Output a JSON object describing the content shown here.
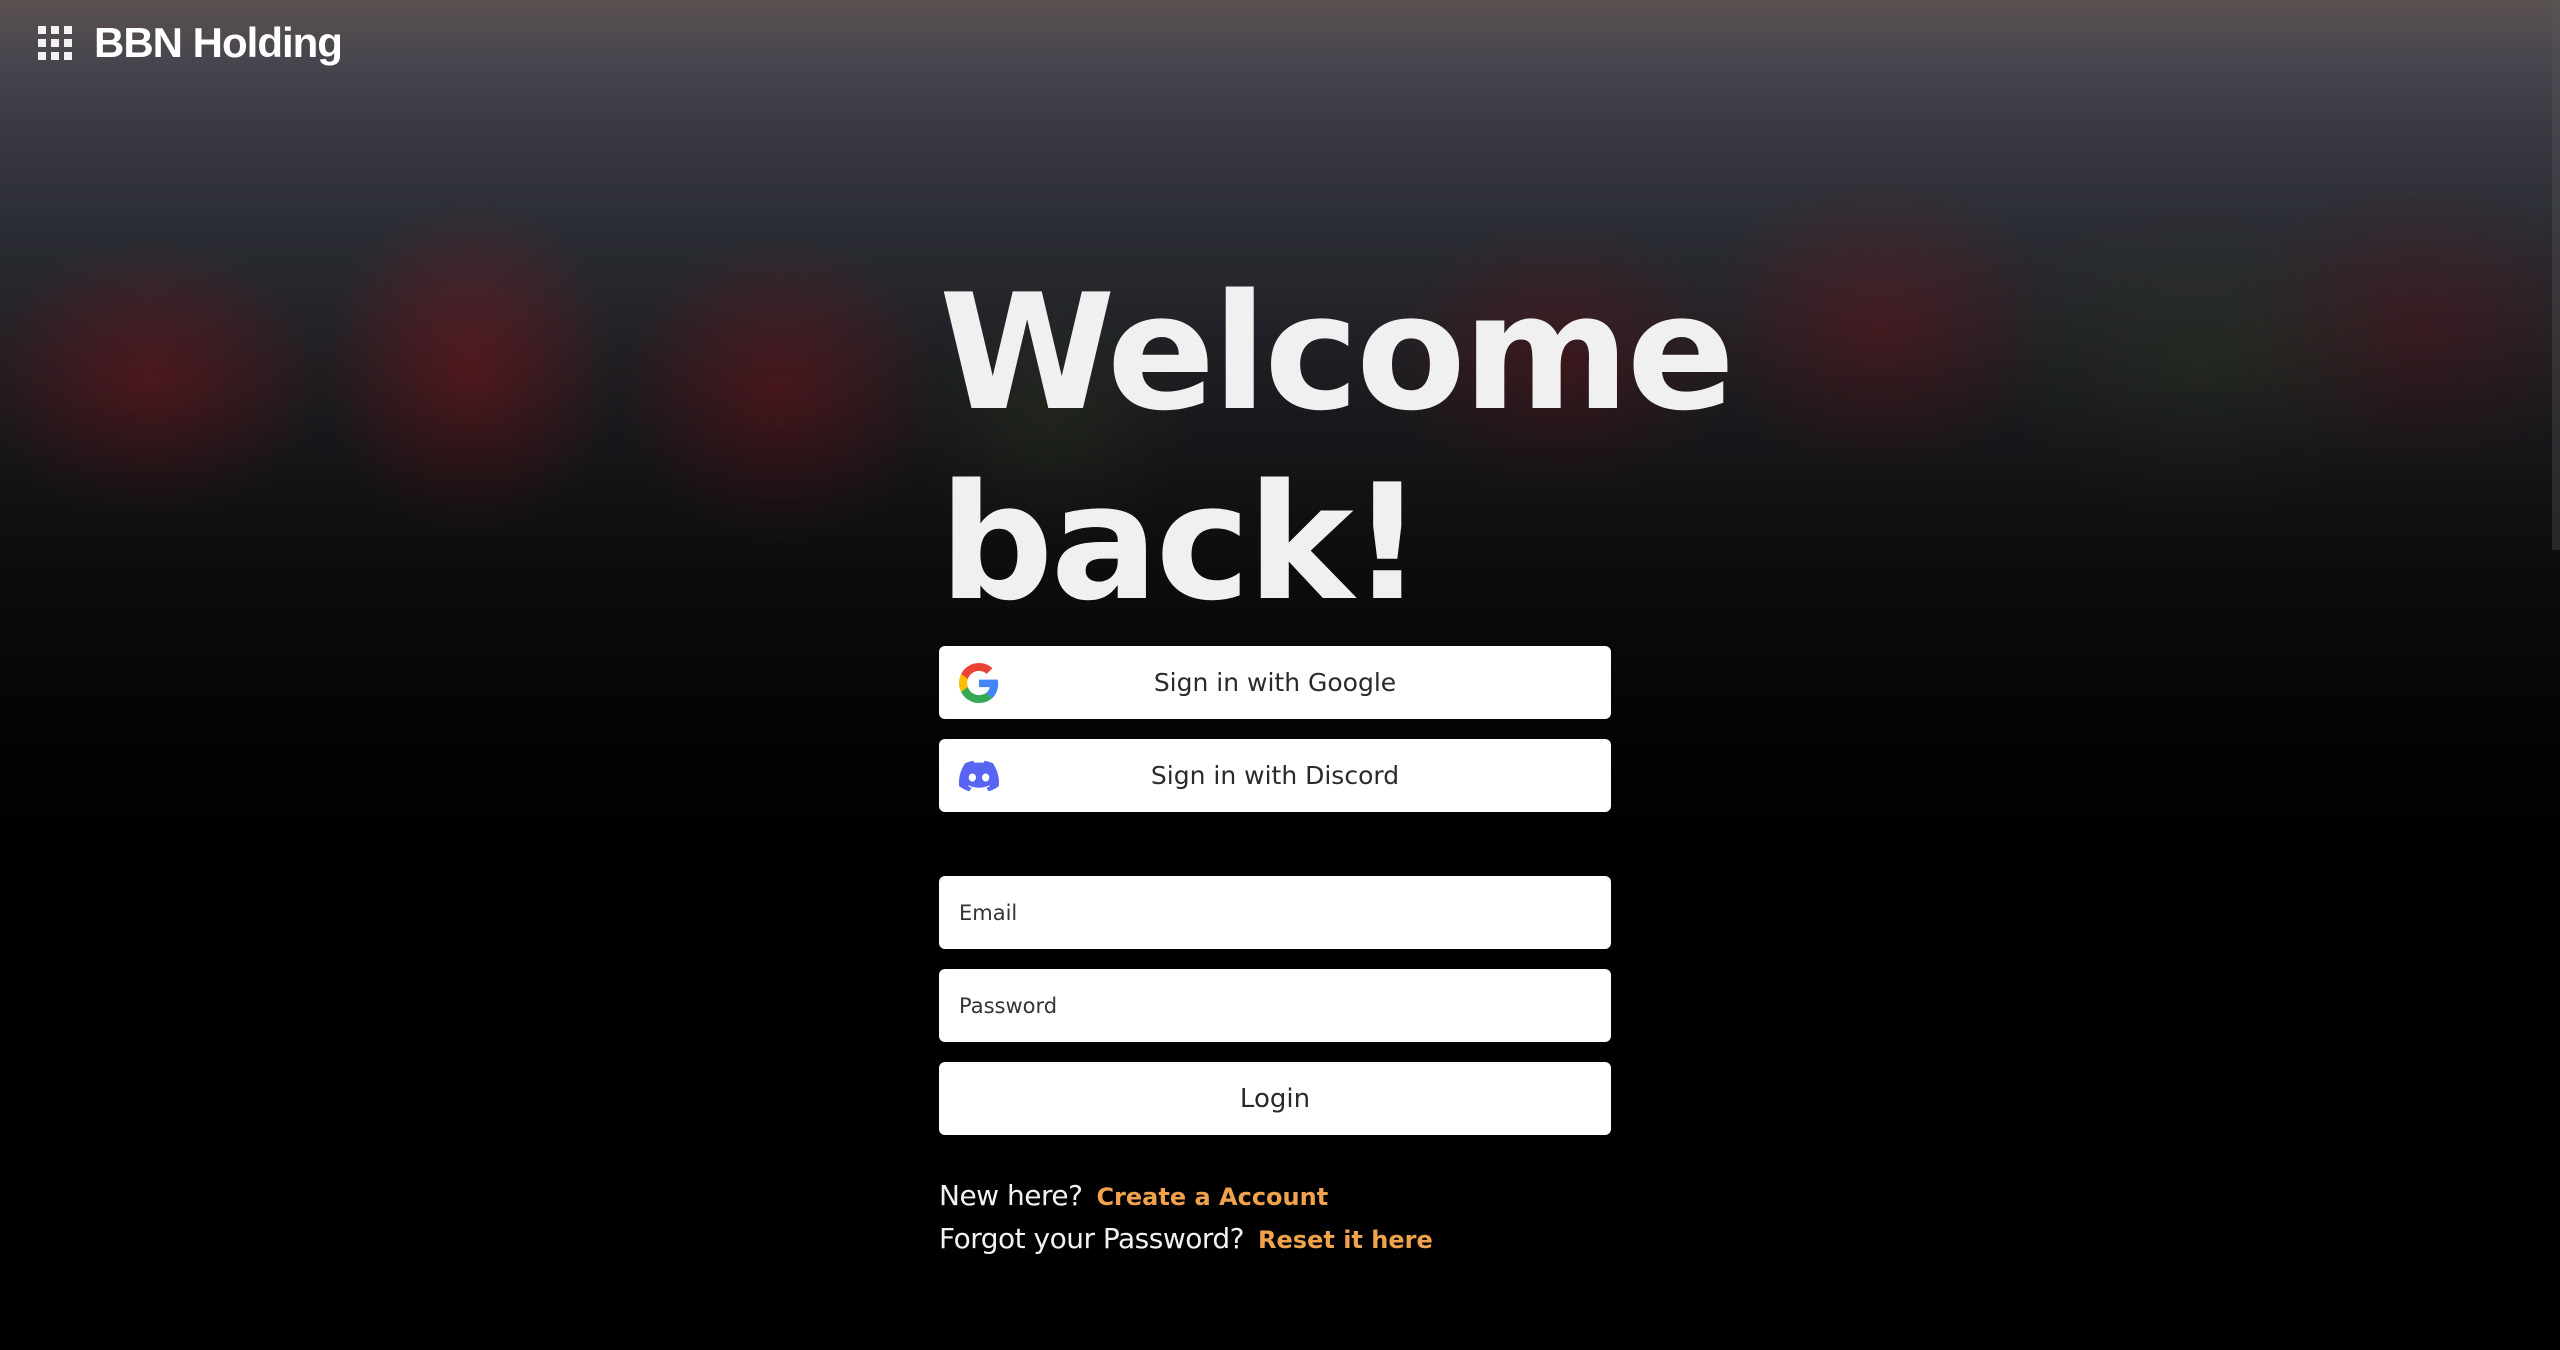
{
  "header": {
    "brand": "BBN Holding"
  },
  "main": {
    "title_line1": "Welcome",
    "title_line2": "back!",
    "google_button": "Sign in with Google",
    "discord_button": "Sign in with Discord",
    "email_placeholder": "Email",
    "password_placeholder": "Password",
    "login_button": "Login"
  },
  "links": {
    "new_here": "New here?",
    "create_account": "Create a Account",
    "forgot_password": "Forgot your Password?",
    "reset": "Reset it here"
  },
  "colors": {
    "link_accent": "#f0a24c",
    "discord_brand": "#5865F2"
  },
  "icons": {
    "menu": "grid-icon",
    "google": "google-icon",
    "discord": "discord-icon"
  }
}
